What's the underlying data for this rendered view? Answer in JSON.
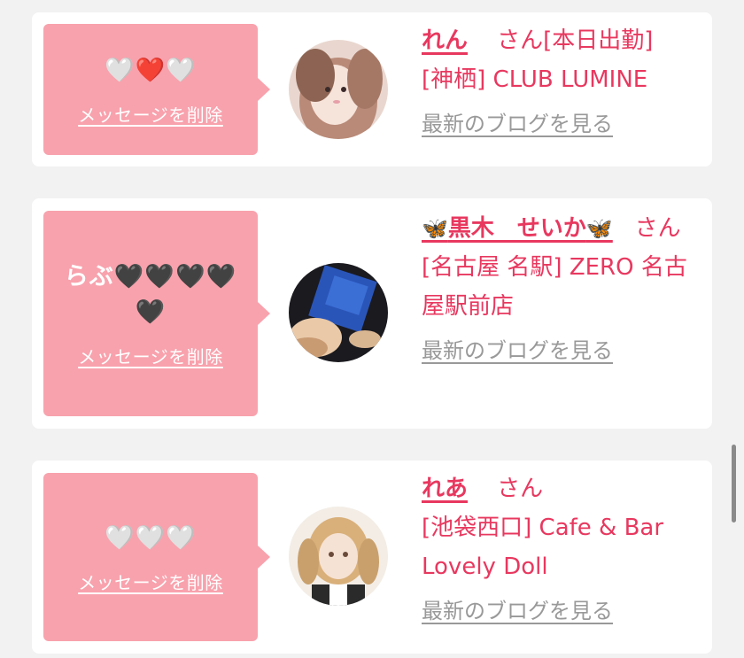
{
  "favorites": [
    {
      "message": "🤍❤️🤍",
      "delete_label": "メッセージを削除",
      "name": "れん",
      "honorific": "さん",
      "status": "[本日出勤]",
      "shop": "[神栖] CLUB LUMINE",
      "blog_label": "最新のブログを見る",
      "avatar_icon": "girl-photo-avatar"
    },
    {
      "message": "らぶ🖤🖤🖤🖤🖤",
      "delete_label": "メッセージを削除",
      "name_prefix": "🦋",
      "name": "黒木　せいか",
      "name_suffix": "🦋",
      "honorific": "さん",
      "shop": "[名古屋 名駅] ZERO 名古屋駅前店",
      "blog_label": "最新のブログを見る",
      "avatar_icon": "girl-photo-avatar"
    },
    {
      "message": "🤍🤍🤍",
      "delete_label": "メッセージを削除",
      "name": "れあ",
      "honorific": "さん",
      "shop": "[池袋西口] Cafe & Bar Lovely Doll",
      "blog_label": "最新のブログを見る",
      "avatar_icon": "girl-photo-avatar"
    }
  ],
  "colors": {
    "accent": "#e8385f",
    "bubble": "#f8a2ad",
    "link_gray": "#999999",
    "background": "#f2f2f2"
  }
}
